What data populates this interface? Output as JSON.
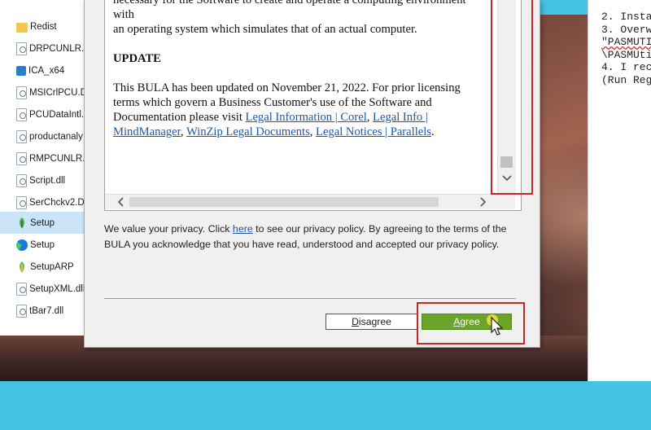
{
  "explorer": {
    "files": [
      {
        "name": "Redist",
        "icon": "folder-icon"
      },
      {
        "name": "DRPCUNLR.c",
        "icon": "dll-icon"
      },
      {
        "name": "ICA_x64",
        "icon": "ica-icon"
      },
      {
        "name": "MSICrlPCU.D",
        "icon": "dll-icon"
      },
      {
        "name": "PCUDataIntl.",
        "icon": "dll-icon"
      },
      {
        "name": "productanaly",
        "icon": "dll-icon"
      },
      {
        "name": "RMPCUNLR.",
        "icon": "dll-icon"
      },
      {
        "name": "Script.dll",
        "icon": "dll-icon"
      },
      {
        "name": "SerChckv2.D",
        "icon": "dll-icon"
      },
      {
        "name": "Setup",
        "icon": "setup-icon"
      },
      {
        "name": "Setup",
        "icon": "edge-icon"
      },
      {
        "name": "SetupARP",
        "icon": "setup-icon"
      },
      {
        "name": "SetupXML.dll",
        "icon": "dll-icon"
      },
      {
        "name": "tBar7.dll",
        "icon": "dll-icon"
      }
    ],
    "selected_index": 9
  },
  "notepad": {
    "lines": [
      "2. Insta",
      "3. Overw",
      "\"PASMUTI",
      "\\PASMUti",
      "4. I rec",
      "(Run Reg"
    ]
  },
  "dialog": {
    "doc": {
      "partial_top_line": "necessary for the Software to create and operate a computing environment with",
      "line2": "an operating system which simulates that of an actual computer.",
      "heading": "UPDATE",
      "para_text": "This BULA has been updated on November 21, 2022. For prior licensing terms which govern a Business Customer's use of the Software and Documentation please visit ",
      "links": [
        "Legal Information | Corel",
        "Legal Info | MindManager",
        "WinZip Legal Documents",
        "Legal Notices | Parallels"
      ],
      "sep1": ", ",
      "sep2": ", ",
      "sep3": ", ",
      "end": "."
    },
    "privacy": {
      "before": "We value your privacy. Click ",
      "link": "here",
      "after": " to see our privacy policy. By agreeing to the terms of the BULA you acknowledge that you have read, understood and accepted our privacy policy."
    },
    "buttons": {
      "disagree_first": "D",
      "disagree_rest": "isagree",
      "agree_first": "A",
      "agree_rest": "gree"
    }
  },
  "colors": {
    "highlight": "#c62828",
    "agree_button": "#6aa42a",
    "link": "#1a56b5",
    "backdrop": "#45c3e4"
  }
}
